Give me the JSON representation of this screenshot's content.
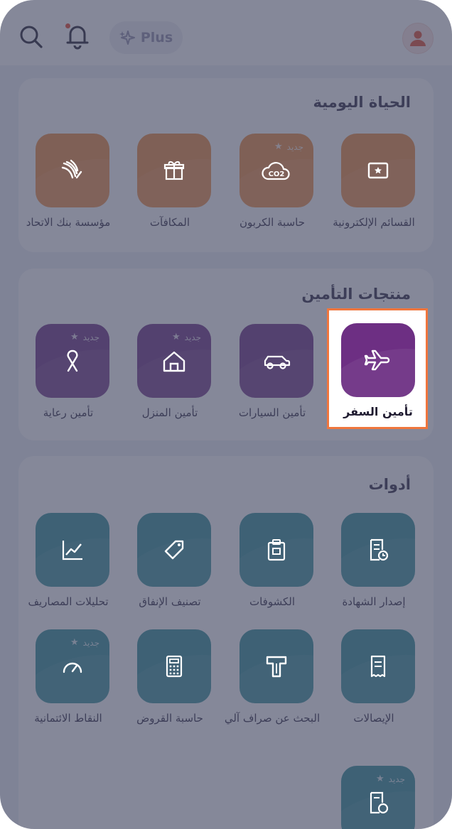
{
  "header": {
    "plus_label": "Plus",
    "icons": [
      "search-icon",
      "bell-icon",
      "sparkle-icon",
      "user-avatar-icon"
    ]
  },
  "sections": {
    "daily": {
      "title": "الحياة اليومية",
      "items": [
        {
          "label": "القسائم الإلكترونية",
          "icon": "voucher-icon",
          "new": false
        },
        {
          "label": "حاسبة الكربون",
          "icon": "co2-cloud-icon",
          "new": true
        },
        {
          "label": "المكافآت",
          "icon": "gift-icon",
          "new": false
        },
        {
          "label": "مؤسسة بنك الاتحاد",
          "icon": "foundation-logo-icon",
          "new": false
        }
      ]
    },
    "insurance": {
      "title": "منتجات التأمين",
      "items": [
        {
          "label": "تأمين السفر",
          "icon": "airplane-icon",
          "new": false
        },
        {
          "label": "تأمين السيارات",
          "icon": "car-icon",
          "new": false
        },
        {
          "label": "تأمين المنزل",
          "icon": "home-icon",
          "new": true
        },
        {
          "label": "تأمين رعاية",
          "icon": "ribbon-icon",
          "new": true
        }
      ]
    },
    "tools": {
      "title": "أدوات",
      "items": [
        {
          "label": "إصدار الشهادة",
          "icon": "certificate-icon",
          "new": false
        },
        {
          "label": "الكشوفات",
          "icon": "statements-icon",
          "new": false
        },
        {
          "label": "تصنيف الإنفاق",
          "icon": "tag-icon",
          "new": false
        },
        {
          "label": "تحليلات المصاريف",
          "icon": "line-chart-icon",
          "new": false
        },
        {
          "label": "الإيصالات",
          "icon": "receipt-icon",
          "new": false
        },
        {
          "label": "البحث عن صراف آلي",
          "icon": "atm-icon",
          "new": false
        },
        {
          "label": "حاسبة القروض",
          "icon": "calculator-icon",
          "new": false
        },
        {
          "label": "النقاط الائتمانية",
          "icon": "gauge-icon",
          "new": true
        },
        {
          "label": "",
          "icon": "document-clock-icon",
          "new": true
        }
      ]
    }
  },
  "new_badge": "جديد",
  "colors": {
    "orange": "#ee8a3c",
    "purple": "#6d2f83",
    "teal": "#2f8e97",
    "highlight": "#f0763d"
  }
}
